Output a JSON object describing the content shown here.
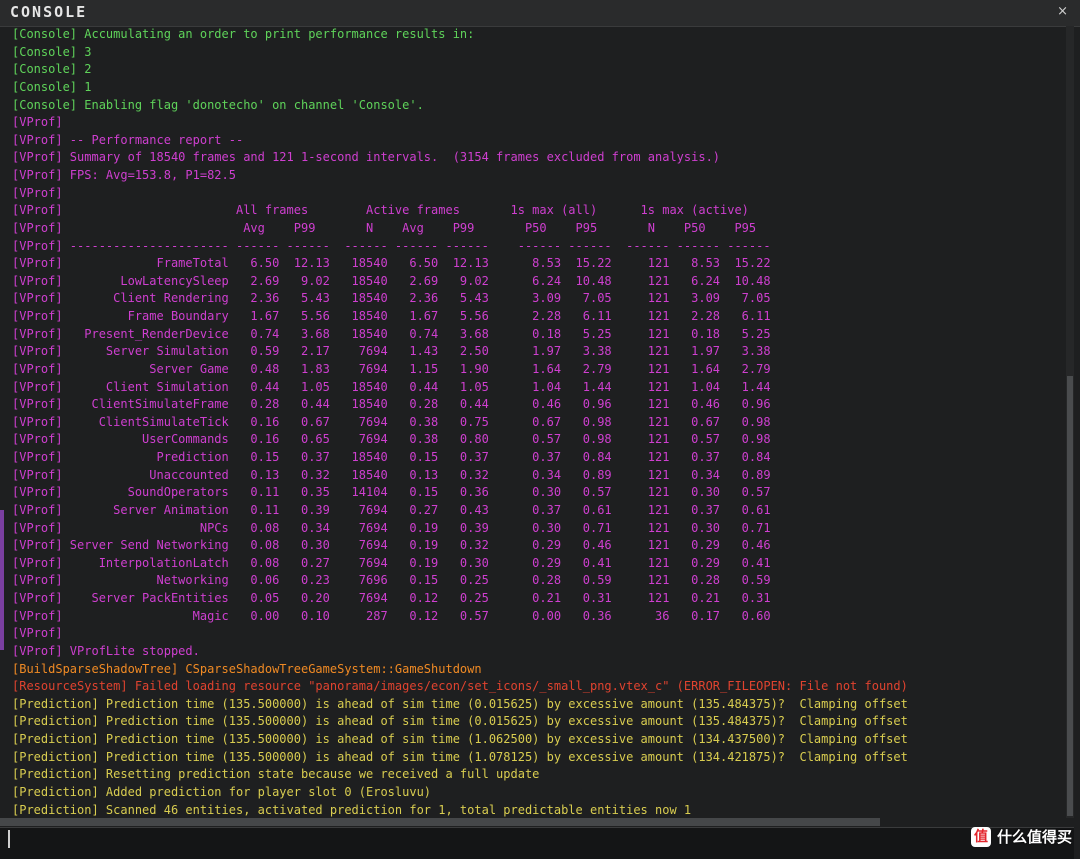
{
  "title": "CONSOLE",
  "close_glyph": "×",
  "colors": {
    "console": "#5fd35a",
    "vprof": "#cf3fd0",
    "build": "#f08a24",
    "resource": "#e0432f",
    "prediction": "#d9cd50"
  },
  "lines": [
    {
      "cls": "console",
      "text": "[Console] Accumulating an order to print performance results in:"
    },
    {
      "cls": "console",
      "text": "[Console] 3"
    },
    {
      "cls": "console",
      "text": "[Console] 2"
    },
    {
      "cls": "console",
      "text": "[Console] 1"
    },
    {
      "cls": "console",
      "text": "[Console] Enabling flag 'donotecho' on channel 'Console'."
    },
    {
      "cls": "vprof",
      "text": "[VProf]"
    },
    {
      "cls": "vprof",
      "text": "[VProf] -- Performance report --"
    },
    {
      "cls": "vprof",
      "text": "[VProf] Summary of 18540 frames and 121 1-second intervals.  (3154 frames excluded from analysis.)"
    },
    {
      "cls": "vprof",
      "text": "[VProf] FPS: Avg=153.8, P1=82.5"
    },
    {
      "cls": "vprof",
      "text": "[VProf]"
    },
    {
      "cls": "vprof",
      "text": "[VProf]                        All frames        Active frames       1s max (all)      1s max (active)"
    },
    {
      "cls": "vprof",
      "text": "[VProf]                         Avg    P99       N    Avg    P99       P50    P95       N    P50    P95"
    },
    {
      "cls": "vprof",
      "text": "[VProf] ---------------------- ------ ------  ------ ------ ------    ------ ------  ------ ------ ------"
    },
    {
      "cls": "vprof",
      "text": "[VProf]             FrameTotal   6.50  12.13   18540   6.50  12.13      8.53  15.22     121   8.53  15.22"
    },
    {
      "cls": "vprof",
      "text": "[VProf]        LowLatencySleep   2.69   9.02   18540   2.69   9.02      6.24  10.48     121   6.24  10.48"
    },
    {
      "cls": "vprof",
      "text": "[VProf]       Client Rendering   2.36   5.43   18540   2.36   5.43      3.09   7.05     121   3.09   7.05"
    },
    {
      "cls": "vprof",
      "text": "[VProf]         Frame Boundary   1.67   5.56   18540   1.67   5.56      2.28   6.11     121   2.28   6.11"
    },
    {
      "cls": "vprof",
      "text": "[VProf]   Present_RenderDevice   0.74   3.68   18540   0.74   3.68      0.18   5.25     121   0.18   5.25"
    },
    {
      "cls": "vprof",
      "text": "[VProf]      Server Simulation   0.59   2.17    7694   1.43   2.50      1.97   3.38     121   1.97   3.38"
    },
    {
      "cls": "vprof",
      "text": "[VProf]            Server Game   0.48   1.83    7694   1.15   1.90      1.64   2.79     121   1.64   2.79"
    },
    {
      "cls": "vprof",
      "text": "[VProf]      Client Simulation   0.44   1.05   18540   0.44   1.05      1.04   1.44     121   1.04   1.44"
    },
    {
      "cls": "vprof",
      "text": "[VProf]    ClientSimulateFrame   0.28   0.44   18540   0.28   0.44      0.46   0.96     121   0.46   0.96"
    },
    {
      "cls": "vprof",
      "text": "[VProf]     ClientSimulateTick   0.16   0.67    7694   0.38   0.75      0.67   0.98     121   0.67   0.98"
    },
    {
      "cls": "vprof",
      "text": "[VProf]           UserCommands   0.16   0.65    7694   0.38   0.80      0.57   0.98     121   0.57   0.98"
    },
    {
      "cls": "vprof",
      "text": "[VProf]             Prediction   0.15   0.37   18540   0.15   0.37      0.37   0.84     121   0.37   0.84"
    },
    {
      "cls": "vprof",
      "text": "[VProf]            Unaccounted   0.13   0.32   18540   0.13   0.32      0.34   0.89     121   0.34   0.89"
    },
    {
      "cls": "vprof",
      "text": "[VProf]         SoundOperators   0.11   0.35   14104   0.15   0.36      0.30   0.57     121   0.30   0.57"
    },
    {
      "cls": "vprof",
      "text": "[VProf]       Server Animation   0.11   0.39    7694   0.27   0.43      0.37   0.61     121   0.37   0.61"
    },
    {
      "cls": "vprof",
      "text": "[VProf]                   NPCs   0.08   0.34    7694   0.19   0.39      0.30   0.71     121   0.30   0.71"
    },
    {
      "cls": "vprof",
      "text": "[VProf] Server Send Networking   0.08   0.30    7694   0.19   0.32      0.29   0.46     121   0.29   0.46"
    },
    {
      "cls": "vprof",
      "text": "[VProf]     InterpolationLatch   0.08   0.27    7694   0.19   0.30      0.29   0.41     121   0.29   0.41"
    },
    {
      "cls": "vprof",
      "text": "[VProf]             Networking   0.06   0.23    7696   0.15   0.25      0.28   0.59     121   0.28   0.59"
    },
    {
      "cls": "vprof",
      "text": "[VProf]    Server PackEntities   0.05   0.20    7694   0.12   0.25      0.21   0.31     121   0.21   0.31"
    },
    {
      "cls": "vprof",
      "text": "[VProf]                  Magic   0.00   0.10     287   0.12   0.57      0.00   0.36      36   0.17   0.60"
    },
    {
      "cls": "vprof",
      "text": "[VProf]"
    },
    {
      "cls": "vprof",
      "text": "[VProf] VProfLite stopped."
    },
    {
      "cls": "build",
      "text": "[BuildSparseShadowTree] CSparseShadowTreeGameSystem::GameShutdown"
    },
    {
      "cls": "resource",
      "text": "[ResourceSystem] Failed loading resource \"panorama/images/econ/set_icons/_small_png.vtex_c\" (ERROR_FILEOPEN: File not found)"
    },
    {
      "cls": "prediction",
      "text": "[Prediction] Prediction time (135.500000) is ahead of sim time (0.015625) by excessive amount (135.484375)?  Clamping offset"
    },
    {
      "cls": "prediction",
      "text": "[Prediction] Prediction time (135.500000) is ahead of sim time (0.015625) by excessive amount (135.484375)?  Clamping offset"
    },
    {
      "cls": "prediction",
      "text": "[Prediction] Prediction time (135.500000) is ahead of sim time (1.062500) by excessive amount (134.437500)?  Clamping offset"
    },
    {
      "cls": "prediction",
      "text": "[Prediction] Prediction time (135.500000) is ahead of sim time (1.078125) by excessive amount (134.421875)?  Clamping offset"
    },
    {
      "cls": "prediction",
      "text": "[Prediction] Resetting prediction state because we received a full update"
    },
    {
      "cls": "prediction",
      "text": "[Prediction] Added prediction for player slot 0 (Erosluvu)"
    },
    {
      "cls": "prediction",
      "text": "[Prediction] Scanned 46 entities, activated prediction for 1, total predictable entities now 1"
    }
  ],
  "input": {
    "value": ""
  },
  "watermark": {
    "badge": "值",
    "text": "什么值得买"
  }
}
